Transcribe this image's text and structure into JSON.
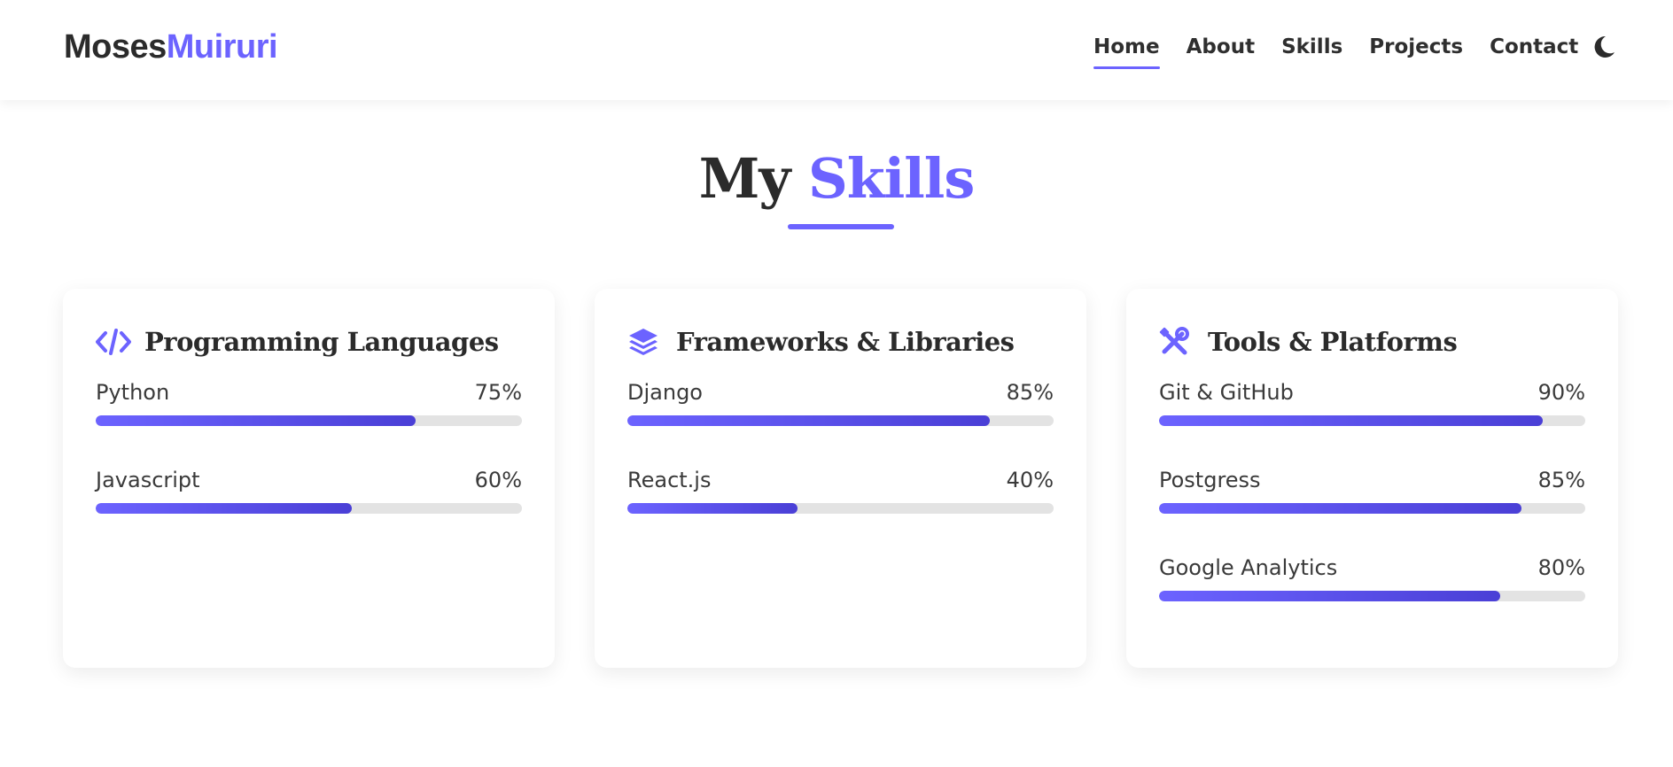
{
  "brand": {
    "first": "Moses",
    "last": "Muiruri"
  },
  "nav": {
    "links": [
      {
        "label": "Home",
        "active": true
      },
      {
        "label": "About",
        "active": false
      },
      {
        "label": "Skills",
        "active": false
      },
      {
        "label": "Projects",
        "active": false
      },
      {
        "label": "Contact",
        "active": false
      }
    ],
    "theme_toggle_icon": "moon-icon"
  },
  "section": {
    "title_word1": "My",
    "title_word2": "Skills"
  },
  "colors": {
    "accent": "#6c63ff",
    "accent_dark": "#4a3fd6",
    "track": "#e3e3e3",
    "text": "#2b2b2b"
  },
  "cards": [
    {
      "icon": "code-icon",
      "title": "Programming Languages",
      "skills": [
        {
          "name": "Python",
          "percent_label": "75%",
          "level": 75
        },
        {
          "name": "Javascript",
          "percent_label": "60%",
          "level": 60
        }
      ]
    },
    {
      "icon": "layers-icon",
      "title": "Frameworks & Libraries",
      "skills": [
        {
          "name": "Django",
          "percent_label": "85%",
          "level": 85
        },
        {
          "name": "React.js",
          "percent_label": "40%",
          "level": 40
        }
      ]
    },
    {
      "icon": "tools-icon",
      "title": "Tools & Platforms",
      "skills": [
        {
          "name": "Git & GitHub",
          "percent_label": "90%",
          "level": 90
        },
        {
          "name": "Postgress",
          "percent_label": "85%",
          "level": 85
        },
        {
          "name": "Google Analytics",
          "percent_label": "80%",
          "level": 80
        }
      ]
    }
  ]
}
